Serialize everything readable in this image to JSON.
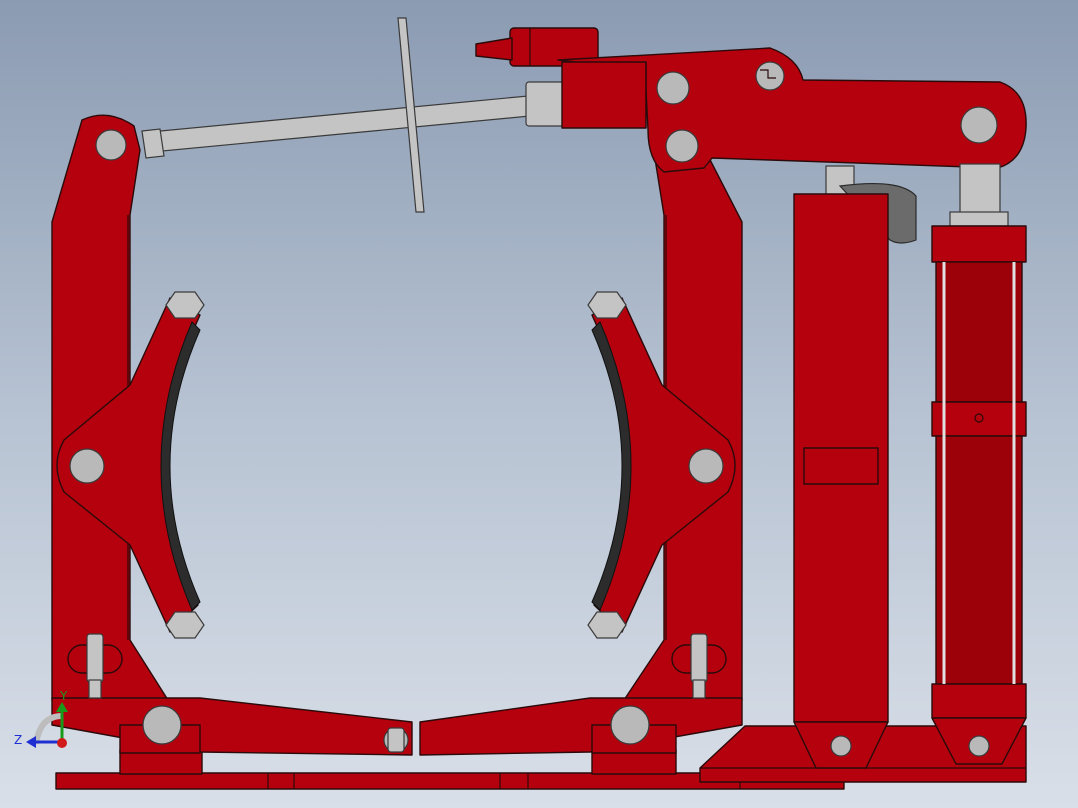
{
  "triad": {
    "y_label": "Y",
    "z_label": "Z",
    "y_color": "#1a9a1a",
    "z_color": "#1f2fd1",
    "x_color": "#d11a1a"
  },
  "colors": {
    "body": "#b5000d",
    "pin": "#b9b9b9",
    "lining": "#2c2c2c",
    "rod": "#c4c4c4"
  },
  "icons": [
    "coordinate-triad-icon"
  ]
}
